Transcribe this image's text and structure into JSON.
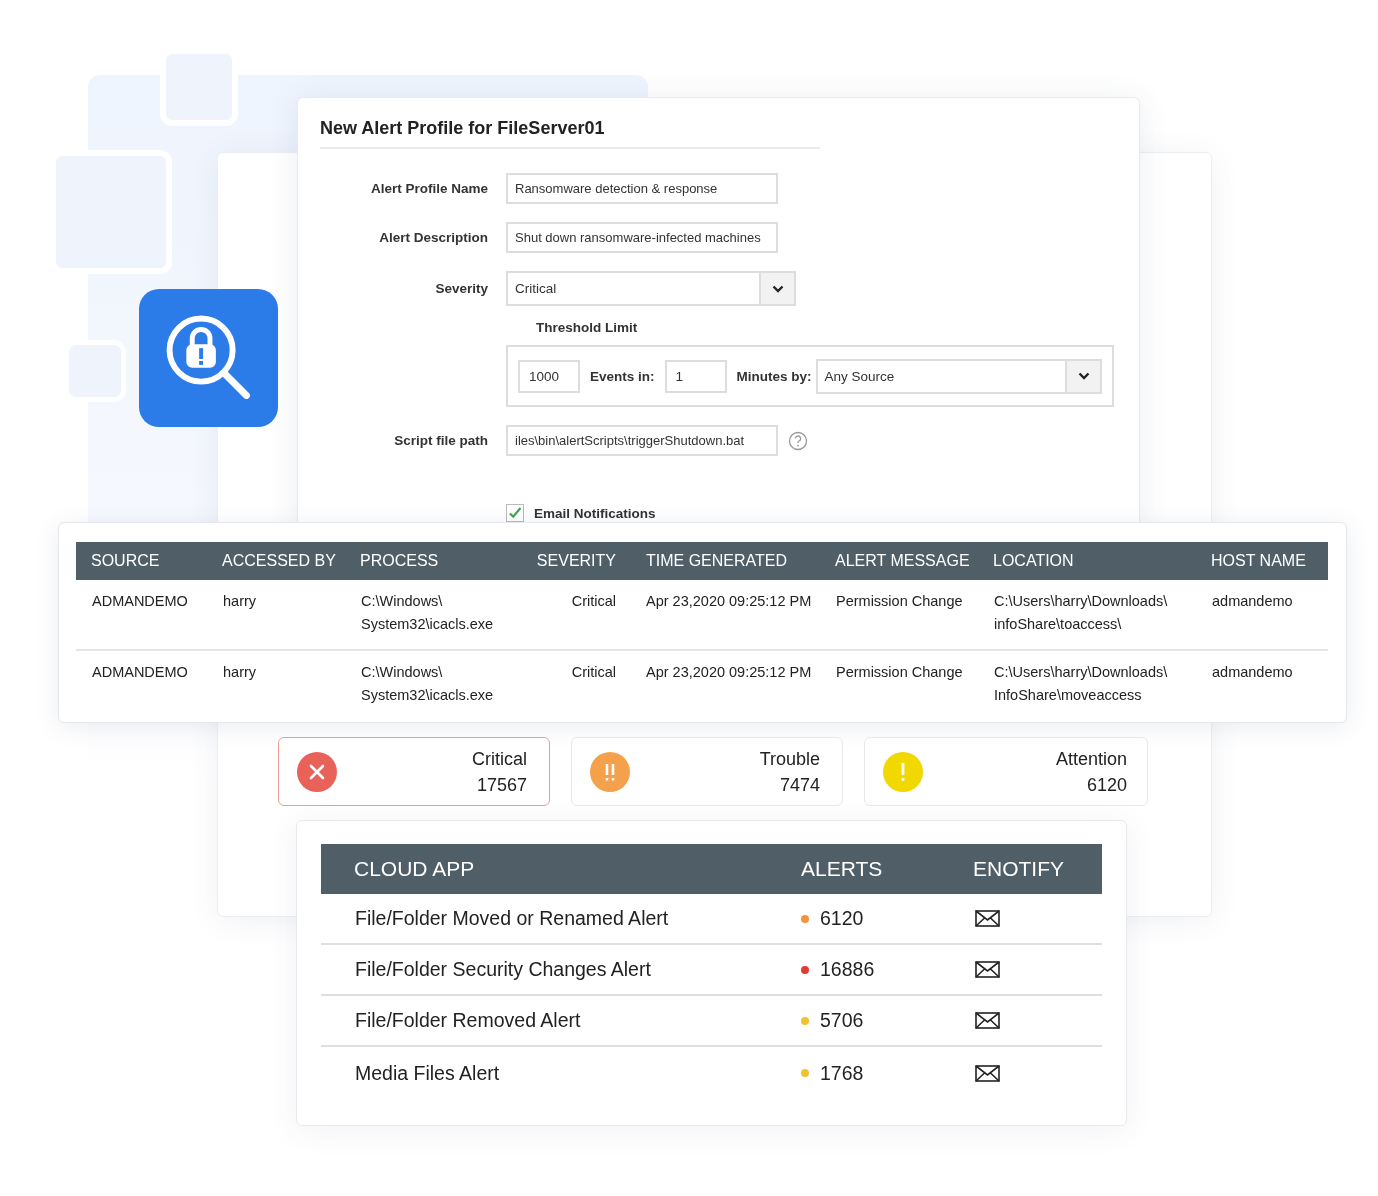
{
  "form": {
    "title": "New Alert Profile for FileServer01",
    "fields": [
      {
        "label": "Alert Profile Name",
        "kind": "text",
        "value": "Ransomware detection & response"
      },
      {
        "label": "Alert Description",
        "kind": "text",
        "value": "Shut down ransomware-infected machines"
      },
      {
        "label": "Severity",
        "kind": "select",
        "value": "Critical"
      }
    ],
    "threshold": {
      "label": "Threshold Limit",
      "count": "1000",
      "events_label": "Events in:",
      "minutes": "1",
      "minutes_label": "Minutes by:",
      "source": "Any Source"
    },
    "script": {
      "label": "Script file path",
      "value": "iles\\bin\\alertScripts\\triggerShutdown.bat"
    },
    "email": {
      "label": "Email Notifications",
      "checked": true
    }
  },
  "events_table": {
    "columns": [
      "SOURCE",
      "ACCESSED BY",
      "PROCESS",
      "SEVERITY",
      "TIME GENERATED",
      "ALERT MESSAGE",
      "LOCATION",
      "HOST NAME"
    ],
    "rows": [
      [
        "ADMANDEMO",
        "harry",
        "C:\\Windows\\System32\\icacls.exe",
        "Critical",
        "Apr 23,2020 09:25:12 PM",
        "Permission Change",
        "C:\\Users\\harry\\Downloads\\infoShare\\toaccess\\",
        "admandemo"
      ],
      [
        "ADMANDEMO",
        "harry",
        "C:\\Windows\\System32\\icacls.exe",
        "Critical",
        "Apr 23,2020 09:25:12 PM",
        "Permission Change",
        "C:\\Users\\harry\\Downloads\\InfoShare\\moveaccess",
        "admandemo"
      ]
    ]
  },
  "status_cards": [
    {
      "kind": "critical",
      "label": "Critical",
      "count": "17567",
      "color": "#e8625a",
      "selected": true
    },
    {
      "kind": "trouble",
      "label": "Trouble",
      "count": "7474",
      "color": "#f5a04a",
      "selected": false
    },
    {
      "kind": "attention",
      "label": "Attention",
      "count": "6120",
      "color": "#f1d800",
      "selected": false
    }
  ],
  "cloud_table": {
    "columns": [
      "CLOUD APP",
      "ALERTS",
      "ENOTIFY"
    ],
    "rows": [
      {
        "name": "File/Folder Moved or Renamed Alert",
        "alerts": "6120",
        "color": "#f5923e"
      },
      {
        "name": "File/Folder Security Changes Alert",
        "alerts": "16886",
        "color": "#e53935"
      },
      {
        "name": "File/Folder Removed Alert",
        "alerts": "5706",
        "color": "#f2c12e"
      },
      {
        "name": "Media Files Alert",
        "alerts": "1768",
        "color": "#f2c12e"
      }
    ]
  }
}
